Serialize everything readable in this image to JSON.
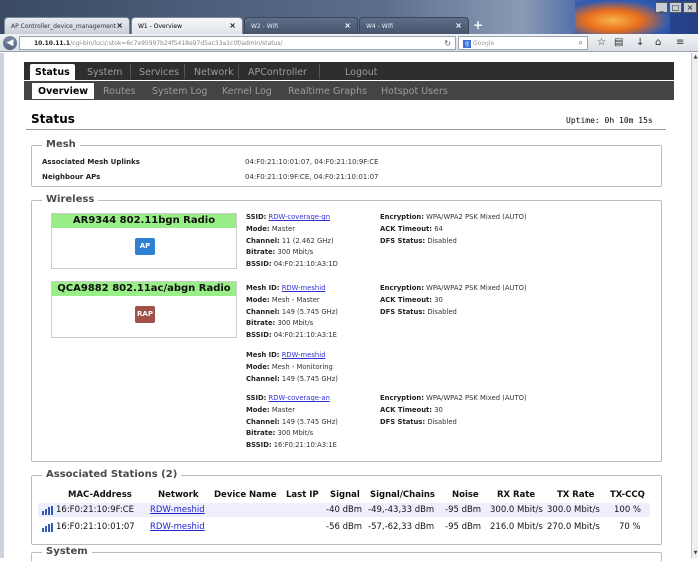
{
  "browser": {
    "tabs": [
      {
        "label": "AP Controller_device_management"
      },
      {
        "label": "W1 - Overview"
      },
      {
        "label": "W2 - Wifi"
      },
      {
        "label": "W4 - Wifi"
      }
    ],
    "url_host": "10.10.11.1",
    "url_rest": "/cgi-bin/luci/;stok=6c7e95997b24f5418e97d5ac33a1c0f/admin/status/",
    "search_placeholder": "Google"
  },
  "mainmenu": [
    "Status",
    "System",
    "Services",
    "Network",
    "APController",
    "Logout"
  ],
  "submenu": [
    "Overview",
    "Routes",
    "System Log",
    "Kernel Log",
    "Realtime Graphs",
    "Hotspot Users"
  ],
  "page": {
    "title": "Status",
    "uptime_label": "Uptime:",
    "uptime_value": "0h 10m 15s"
  },
  "mesh": {
    "legend": "Mesh",
    "rows": [
      {
        "label": "Associated Mesh Uplinks",
        "value": "04:F0:21:10:01:07, 04:F0:21:10:9F:CE"
      },
      {
        "label": "Neighbour APs",
        "value": "04:F0:21:10:9F:CE, 04:F0:21:10:01:07"
      }
    ]
  },
  "wireless": {
    "legend": "Wireless",
    "radios": [
      {
        "title": "AR9344 802.11bgn Radio",
        "badge": "AP"
      },
      {
        "title": "QCA9882 802.11ac/abgn Radio",
        "badge": "RAP"
      }
    ],
    "net1": {
      "k_ssid": "SSID:",
      "ssid": "RDW-coverage-gn",
      "k_mode": "Mode:",
      "mode": "Master",
      "k_channel": "Channel:",
      "channel": "11 (2.462 GHz)",
      "k_bitrate": "Bitrate:",
      "bitrate": "300 Mbit/s",
      "k_bssid": "BSSID:",
      "bssid": "04:F0:21:10:A3:1D",
      "k_enc": "Encryption:",
      "enc": "WPA/WPA2 PSK Mixed (AUTO)",
      "k_ack": "ACK Timeout:",
      "ack": "64",
      "k_dfs": "DFS Status:",
      "dfs": "Disabled"
    },
    "net2": {
      "k_meshid": "Mesh ID:",
      "meshid": "RDW-meshid",
      "k_mode": "Mode:",
      "mode": "Mesh - Master",
      "k_channel": "Channel:",
      "channel": "149 (5.745 GHz)",
      "k_bitrate": "Bitrate:",
      "bitrate": "300 Mbit/s",
      "k_bssid": "BSSID:",
      "bssid": "04:F0:21:10:A3:1E",
      "k_enc": "Encryption:",
      "enc": "WPA/WPA2 PSK Mixed (AUTO)",
      "k_ack": "ACK Timeout:",
      "ack": "30",
      "k_dfs": "DFS Status:",
      "dfs": "Disabled"
    },
    "net3": {
      "k_meshid": "Mesh ID:",
      "meshid": "RDW-meshid",
      "k_mode": "Mode:",
      "mode": "Mesh - Monitoring",
      "k_channel": "Channel:",
      "channel": "149 (5.745 GHz)"
    },
    "net4": {
      "k_ssid": "SSID:",
      "ssid": "RDW-coverage-an",
      "k_mode": "Mode:",
      "mode": "Master",
      "k_channel": "Channel:",
      "channel": "149 (5.745 GHz)",
      "k_bitrate": "Bitrate:",
      "bitrate": "300 Mbit/s",
      "k_bssid": "BSSID:",
      "bssid": "16:F0:21:10:A3:1E",
      "k_enc": "Encryption:",
      "enc": "WPA/WPA2 PSK Mixed (AUTO)",
      "k_ack": "ACK Timeout:",
      "ack": "30",
      "k_dfs": "DFS Status:",
      "dfs": "Disabled"
    }
  },
  "stations": {
    "legend": "Associated Stations (2)",
    "headers": [
      "MAC-Address",
      "Network",
      "Device Name",
      "Last IP",
      "Signal",
      "Signal/Chains",
      "Noise",
      "RX Rate",
      "TX Rate",
      "TX-CCQ"
    ],
    "rows": [
      {
        "mac": "16:F0:21:10:9F:CE",
        "network": "RDW-meshid",
        "device": "",
        "ip": "",
        "signal": "-40 dBm",
        "chains": "-49,-43,33 dBm",
        "noise": "-95 dBm",
        "rx": "300.0 Mbit/s",
        "tx": "300.0 Mbit/s",
        "ccq": "100 %"
      },
      {
        "mac": "16:F0:21:10:01:07",
        "network": "RDW-meshid",
        "device": "",
        "ip": "",
        "signal": "-56 dBm",
        "chains": "-57,-62,33 dBm",
        "noise": "-95 dBm",
        "rx": "216.0 Mbit/s",
        "tx": "270.0 Mbit/s",
        "ccq": "70 %"
      }
    ]
  },
  "system": {
    "legend": "System"
  }
}
